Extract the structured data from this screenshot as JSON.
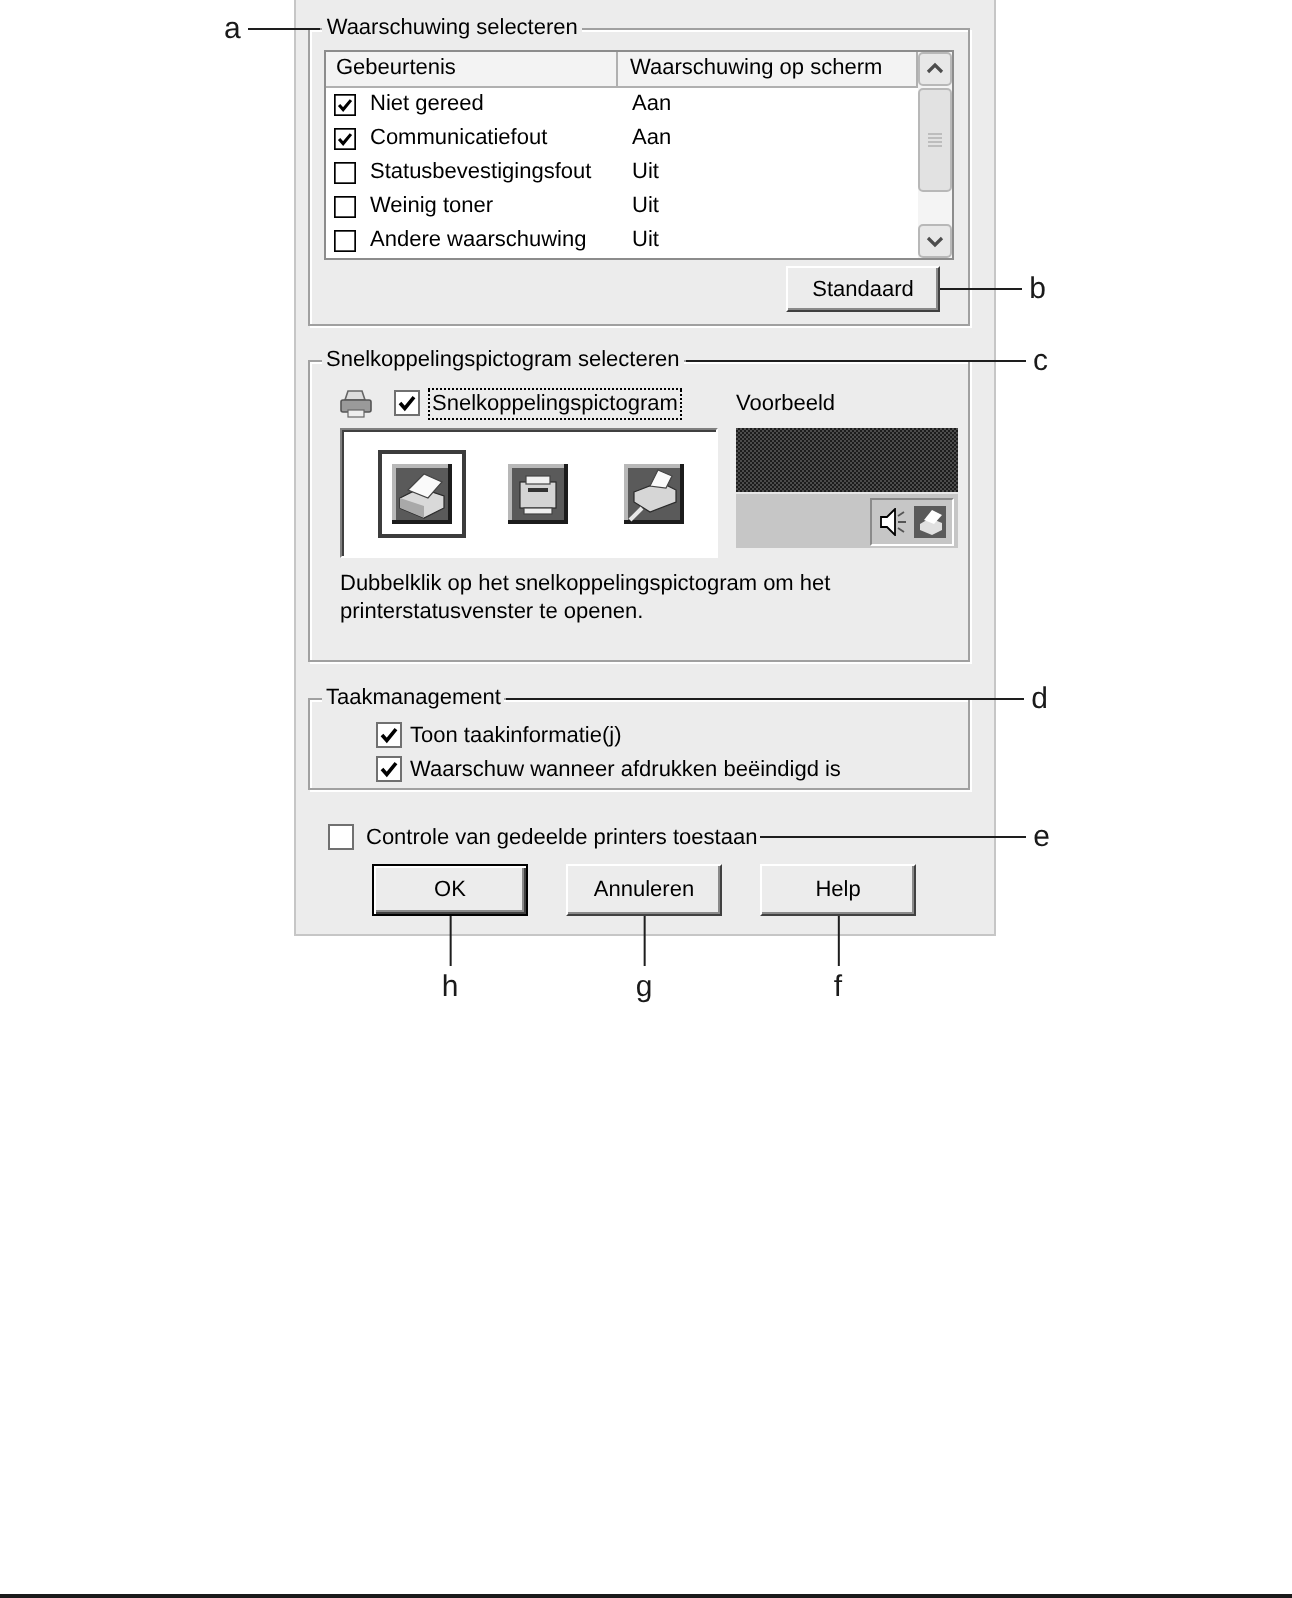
{
  "alerts_group": {
    "title": "Waarschuwing selecteren",
    "callout_left": "a",
    "columns": [
      "Gebeurtenis",
      "Waarschuwing op scherm"
    ],
    "rows": [
      {
        "event": "Niet gereed",
        "checked": true,
        "on_screen": "Aan"
      },
      {
        "event": "Communicatiefout",
        "checked": true,
        "on_screen": "Aan"
      },
      {
        "event": "Statusbevestigingsfout",
        "checked": false,
        "on_screen": "Uit"
      },
      {
        "event": "Weinig toner",
        "checked": false,
        "on_screen": "Uit"
      },
      {
        "event": "Andere waarschuwing",
        "checked": false,
        "on_screen": "Uit"
      }
    ],
    "default_button": {
      "label": "Standaard",
      "callout": "b"
    }
  },
  "icon_group": {
    "title": "Snelkoppelingspictogram selecteren",
    "callout": "c",
    "shortcut": {
      "label": "Snelkoppelingspictogram",
      "checked": true,
      "focused": true
    },
    "icons": [
      {
        "kind": "laser",
        "selected": true
      },
      {
        "kind": "desktop",
        "selected": false
      },
      {
        "kind": "inkjet",
        "selected": false
      }
    ],
    "preview_label": "Voorbeeld",
    "description": "Dubbelklik op het snelkoppelingspictogram om het printerstatusvenster te openen."
  },
  "job_group": {
    "title": "Taakmanagement",
    "callout": "d",
    "options": [
      {
        "label": "Toon taakinformatie(j)",
        "checked": true
      },
      {
        "label": "Waarschuw wanneer afdrukken beëindigd is",
        "checked": true
      }
    ]
  },
  "shared_printers": {
    "label": "Controle van gedeelde printers toestaan",
    "checked": false,
    "callout": "e"
  },
  "buttons": [
    {
      "label": "OK",
      "default": true,
      "callout": "h"
    },
    {
      "label": "Annuleren",
      "default": false,
      "callout": "g"
    },
    {
      "label": "Help",
      "default": false,
      "callout": "f"
    }
  ]
}
